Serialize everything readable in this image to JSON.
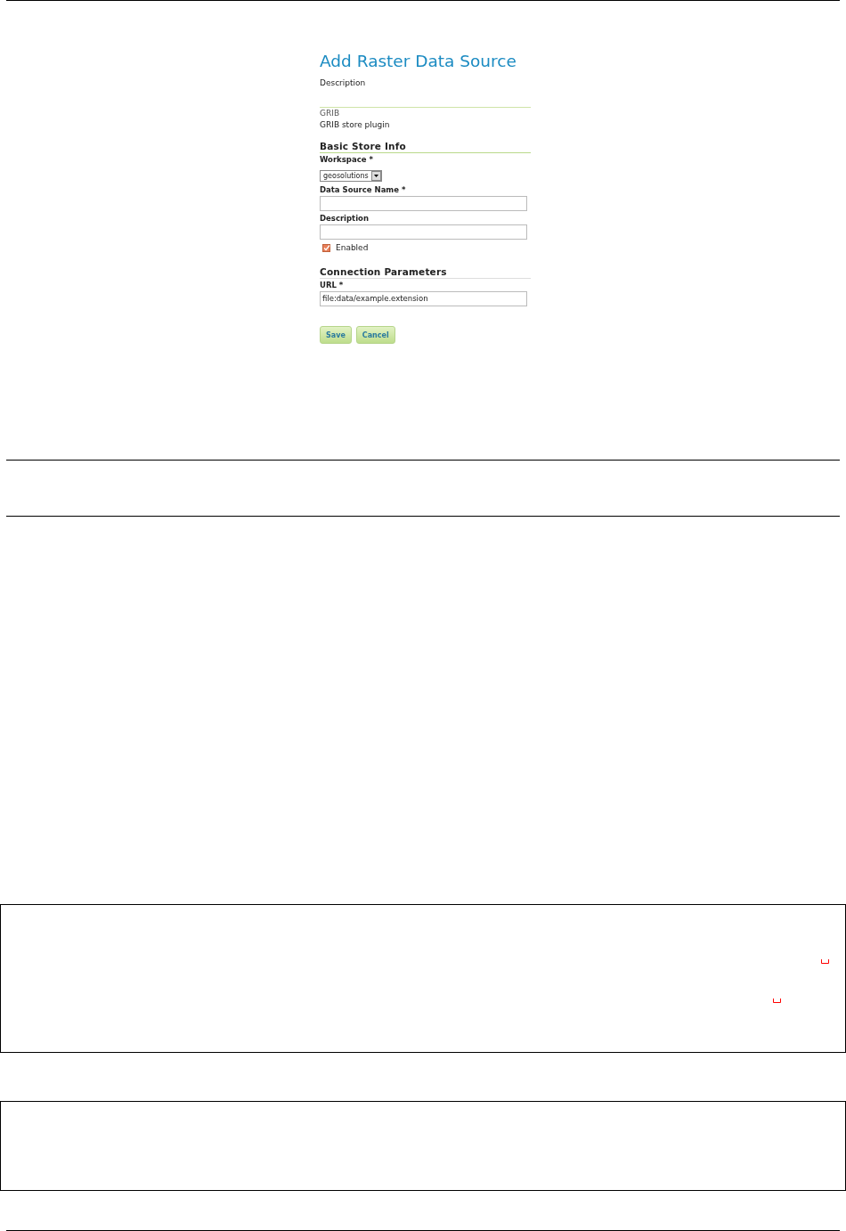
{
  "form": {
    "title": "Add Raster Data Source",
    "description": "Description",
    "store_type": {
      "name": "GRIB",
      "description": "GRIB store plugin"
    },
    "basic_section": {
      "heading": "Basic Store Info",
      "workspace": {
        "label": "Workspace *",
        "value": "geosolutions"
      },
      "fields": [
        {
          "label": "Data Source Name *"
        },
        {
          "label": "Description"
        }
      ],
      "enabled": {
        "label": "Enabled",
        "checked": true
      }
    },
    "connection_section": {
      "heading": "Connection Parameters",
      "fields": [
        {
          "label": "URL *",
          "value": "file:data/example.extension"
        }
      ]
    },
    "buttons": [
      "Save",
      "Cancel"
    ]
  }
}
